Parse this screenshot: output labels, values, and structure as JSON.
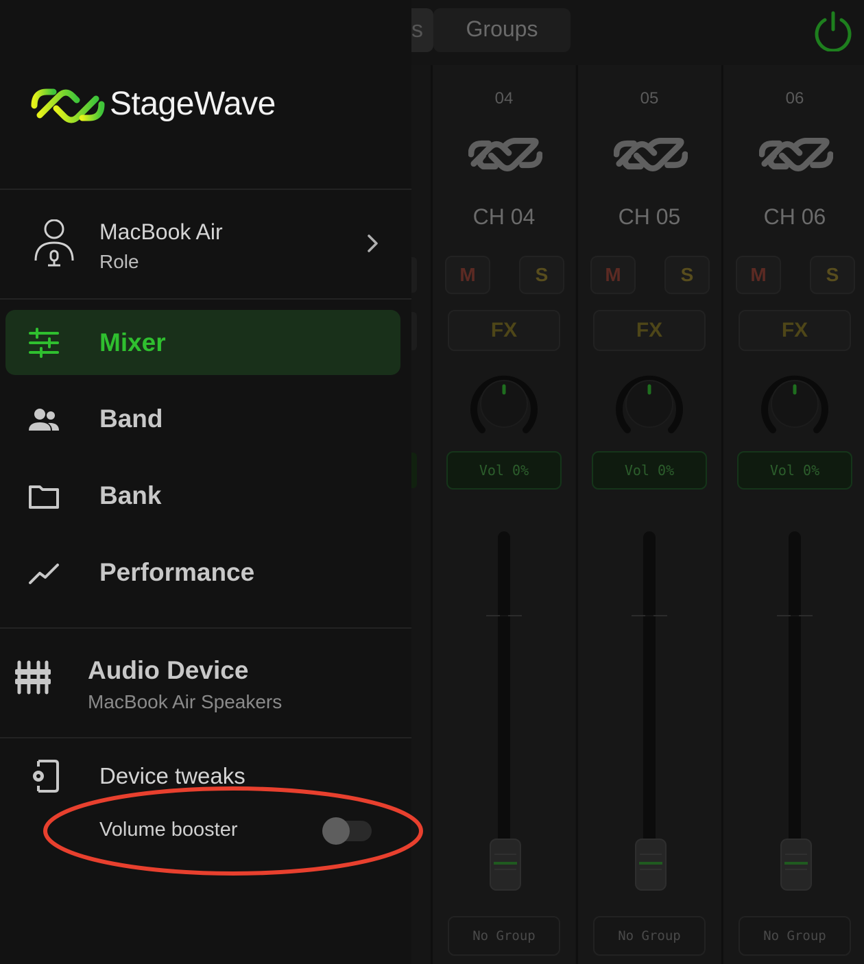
{
  "app": {
    "brand": "StageWave"
  },
  "mixer": {
    "tabs": {
      "previous_partial": "s",
      "groups": "Groups"
    },
    "channels": [
      {
        "number": "04",
        "name": "CH 04",
        "mute": "M",
        "solo": "S",
        "fx": "FX",
        "volume": "Vol 0%",
        "group": "No Group"
      },
      {
        "number": "05",
        "name": "CH 05",
        "mute": "M",
        "solo": "S",
        "fx": "FX",
        "volume": "Vol 0%",
        "group": "No Group"
      },
      {
        "number": "06",
        "name": "CH 06",
        "mute": "M",
        "solo": "S",
        "fx": "FX",
        "volume": "Vol 0%",
        "group": "No Group"
      }
    ]
  },
  "drawer": {
    "profile": {
      "name": "MacBook Air",
      "role": "Role"
    },
    "nav": [
      {
        "label": "Mixer",
        "icon": "sliders-icon",
        "active": true
      },
      {
        "label": "Band",
        "icon": "people-icon",
        "active": false
      },
      {
        "label": "Bank",
        "icon": "folder-icon",
        "active": false
      },
      {
        "label": "Performance",
        "icon": "trend-line-icon",
        "active": false
      }
    ],
    "audio_device": {
      "title": "Audio Device",
      "name": "MacBook Air Speakers"
    },
    "device_tweaks": {
      "title": "Device tweaks",
      "volume_booster": {
        "label": "Volume booster",
        "enabled": false
      }
    }
  },
  "colors": {
    "accent_green": "#2fbf2f",
    "highlight_red": "#e8402e",
    "power_green": "#1e7f1e"
  }
}
